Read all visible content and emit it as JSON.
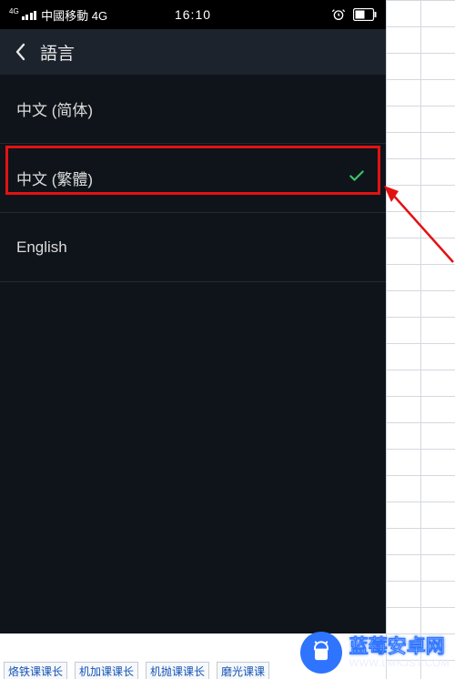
{
  "status": {
    "carrier": "中國移動 4G",
    "time": "16:10"
  },
  "header": {
    "title": "語言"
  },
  "languages": [
    {
      "label": "中文 (简体)",
      "selected": false
    },
    {
      "label": "中文 (繁體)",
      "selected": true
    },
    {
      "label": "English",
      "selected": false
    }
  ],
  "bottomTabs": [
    "烙铁课课长",
    "机加课课长",
    "机抛课课长",
    "磨光课课"
  ],
  "watermark": {
    "title": "蓝莓安卓网",
    "url": "WWW.LMKJST.COM"
  }
}
